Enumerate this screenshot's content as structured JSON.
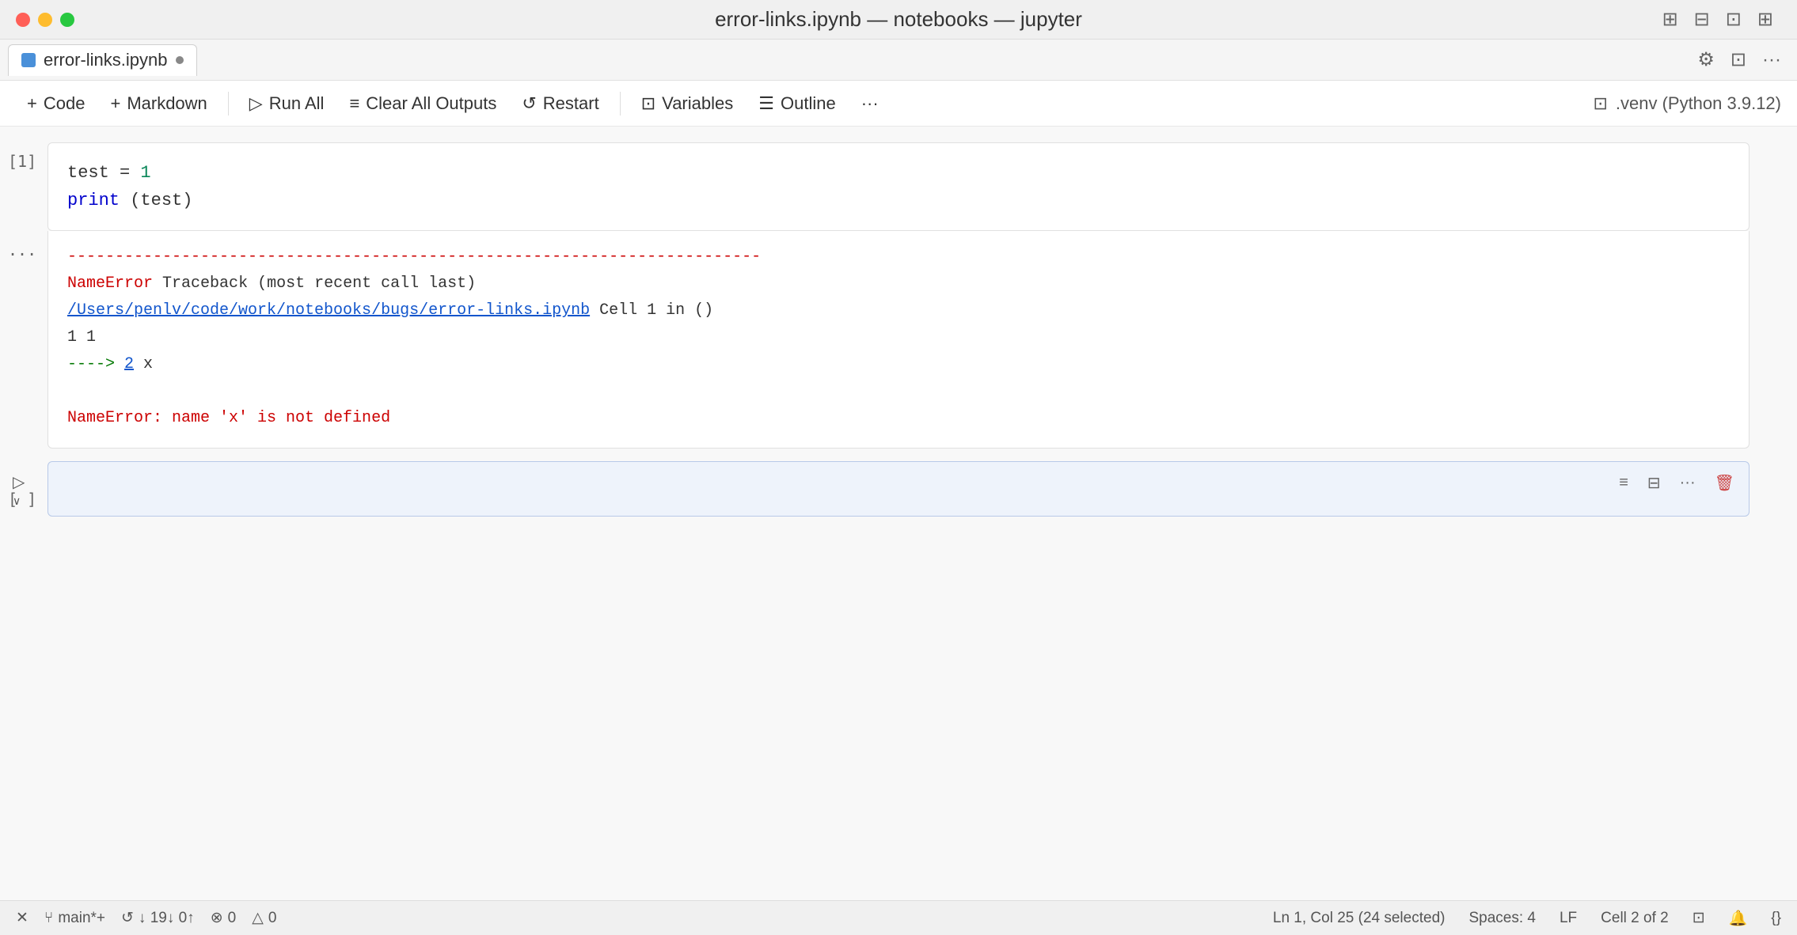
{
  "titleBar": {
    "title": "error-links.ipynb — notebooks — jupyter",
    "controls": [
      "⊞",
      "⊟",
      "⊡",
      "⊞"
    ]
  },
  "tabBar": {
    "tab": {
      "label": "error-links.ipynb",
      "modified": true
    },
    "rightControls": [
      "⚙",
      "⊡",
      "···"
    ]
  },
  "toolbar": {
    "buttons": [
      {
        "id": "add-code",
        "icon": "+",
        "label": "Code"
      },
      {
        "id": "add-markdown",
        "icon": "+",
        "label": "Markdown"
      },
      {
        "id": "run-all",
        "icon": "▷",
        "label": "Run All"
      },
      {
        "id": "clear-outputs",
        "icon": "≡",
        "label": "Clear All Outputs"
      },
      {
        "id": "restart",
        "icon": "↺",
        "label": "Restart"
      },
      {
        "id": "variables",
        "icon": "⊡",
        "label": "Variables"
      },
      {
        "id": "outline",
        "icon": "☰",
        "label": "Outline"
      },
      {
        "id": "more",
        "icon": "···",
        "label": ""
      }
    ],
    "rightLabel": ".venv (Python 3.9.12)"
  },
  "cells": {
    "cell1": {
      "number": "[1]",
      "code": [
        {
          "parts": [
            {
              "text": "test",
              "color": "normal"
            },
            {
              "text": " = ",
              "color": "normal"
            },
            {
              "text": "1",
              "color": "number"
            }
          ]
        },
        {
          "parts": [
            {
              "text": "print",
              "color": "blue"
            },
            {
              "text": "(test)",
              "color": "normal"
            }
          ]
        }
      ]
    },
    "output1": {
      "number": "...",
      "separator": "-------------------------------------------------------------------------",
      "errorType": "NameError",
      "tracebackLabel": "Traceback (most recent call last)",
      "filePath": "/Users/penlv/code/work/notebooks/bugs/error-links.ipynb",
      "cellRef": " Cell 1 in ()",
      "line1": "    1 1",
      "arrowLine": "----> 2 x",
      "errorMessage": "NameError: name 'x' is not defined"
    },
    "cell2": {
      "number": "[ ]",
      "placeholder": ""
    }
  },
  "statusBar": {
    "closeIcon": "✕",
    "branch": "main*+",
    "sync": "↓ 19↓ 0↑",
    "errors": "⊗ 0",
    "warnings": "△ 0",
    "position": "Ln 1, Col 25 (24 selected)",
    "spaces": "Spaces: 4",
    "lineEnding": "LF",
    "cellPosition": "Cell 2 of 2",
    "notebookIcon": "⊡",
    "bellIcon": "🔔",
    "braceIcon": "{}"
  }
}
